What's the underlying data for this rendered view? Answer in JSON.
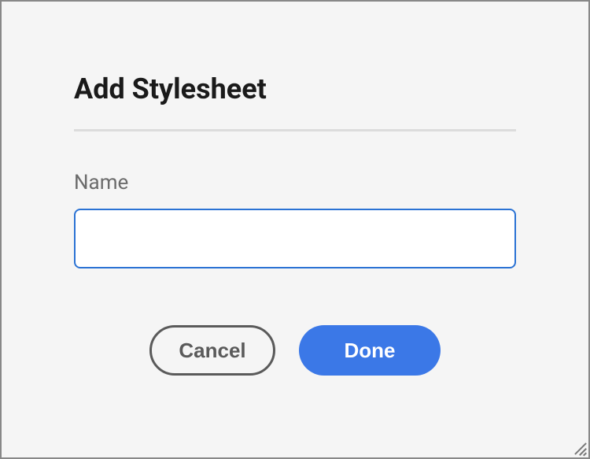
{
  "dialog": {
    "title": "Add Stylesheet",
    "field": {
      "label": "Name",
      "value": ""
    },
    "buttons": {
      "cancel": "Cancel",
      "done": "Done"
    }
  }
}
